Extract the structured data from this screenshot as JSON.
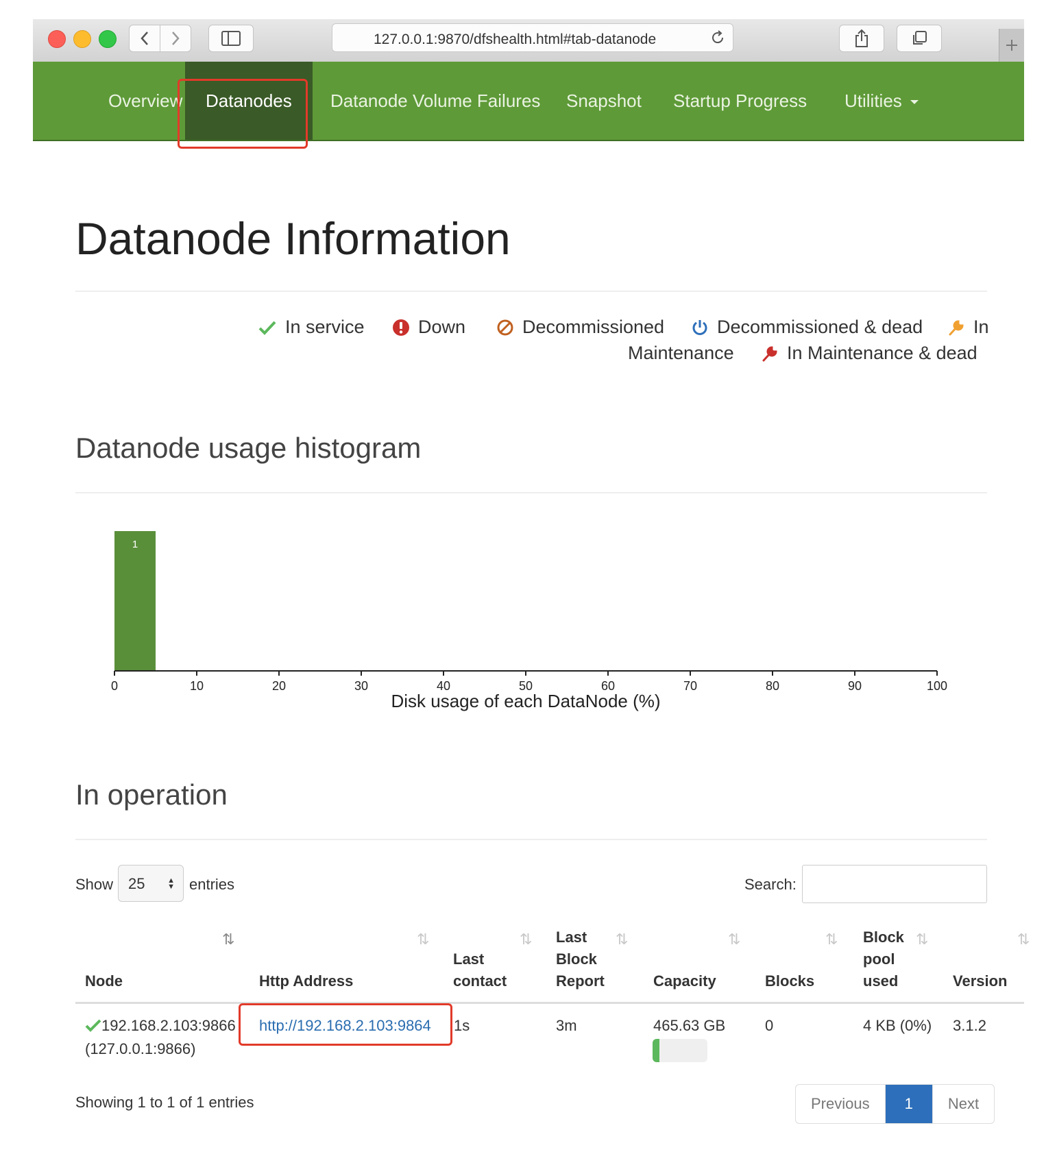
{
  "browser": {
    "url": "127.0.0.1:9870/dfshealth.html#tab-datanode"
  },
  "nav": {
    "items": [
      {
        "label": "Overview",
        "active": false
      },
      {
        "label": "Datanodes",
        "active": true
      },
      {
        "label": "Datanode Volume Failures",
        "active": false
      },
      {
        "label": "Snapshot",
        "active": false
      },
      {
        "label": "Startup Progress",
        "active": false
      },
      {
        "label": "Utilities",
        "active": false
      }
    ]
  },
  "page": {
    "title": "Datanode Information"
  },
  "legend": [
    {
      "icon": "check-icon",
      "label": "In service",
      "color": "#5cb85c"
    },
    {
      "icon": "exclamation-icon",
      "label": "Down",
      "color": "#c9302c"
    },
    {
      "icon": "ban-icon",
      "label": "Decommissioned",
      "color": "#c0601f"
    },
    {
      "icon": "power-icon",
      "label": "Decommissioned & dead",
      "color": "#2d6fba"
    },
    {
      "icon": "wrench-icon",
      "label": "In Maintenance",
      "color": "#f0a030"
    },
    {
      "icon": "wrench-icon",
      "label": "In Maintenance & dead",
      "color": "#c9302c"
    }
  ],
  "histogram": {
    "heading": "Datanode usage histogram",
    "chart_data": {
      "type": "bar",
      "x_bins": [
        [
          0,
          5
        ]
      ],
      "values": [
        1
      ],
      "data_labels": [
        "1"
      ],
      "xlabel": "Disk usage of each DataNode (%)",
      "xlim": [
        0,
        100
      ],
      "xticks": [
        "0",
        "10",
        "20",
        "30",
        "40",
        "50",
        "60",
        "70",
        "80",
        "90",
        "100"
      ],
      "bar_color": "#5a8f3a"
    }
  },
  "operation": {
    "heading": "In operation",
    "show_label": "Show",
    "entries_value": "25",
    "entries_label": "entries",
    "search_label": "Search:",
    "search_value": "",
    "columns": {
      "node": "Node",
      "http": "Http Address",
      "last_contact_1": "Last",
      "last_contact_2": "contact",
      "lbr_1": "Last",
      "lbr_2": "Block",
      "lbr_3": "Report",
      "capacity": "Capacity",
      "blocks": "Blocks",
      "bpu_1": "Block",
      "bpu_2": "pool",
      "bpu_3": "used",
      "version": "Version"
    },
    "row": {
      "node_1": "192.168.2.103:9866",
      "node_2": "(127.0.0.1:9866)",
      "http": "http://192.168.2.103:9864",
      "last_contact": "1s",
      "last_block_report": "3m",
      "capacity": "465.63 GB",
      "capacity_used_fraction": 0.01,
      "blocks": "0",
      "block_pool_used": "4 KB (0%)",
      "version": "3.1.2"
    },
    "showing": "Showing 1 to 1 of 1 entries",
    "pagination": {
      "previous": "Previous",
      "current": "1",
      "next": "Next"
    }
  }
}
